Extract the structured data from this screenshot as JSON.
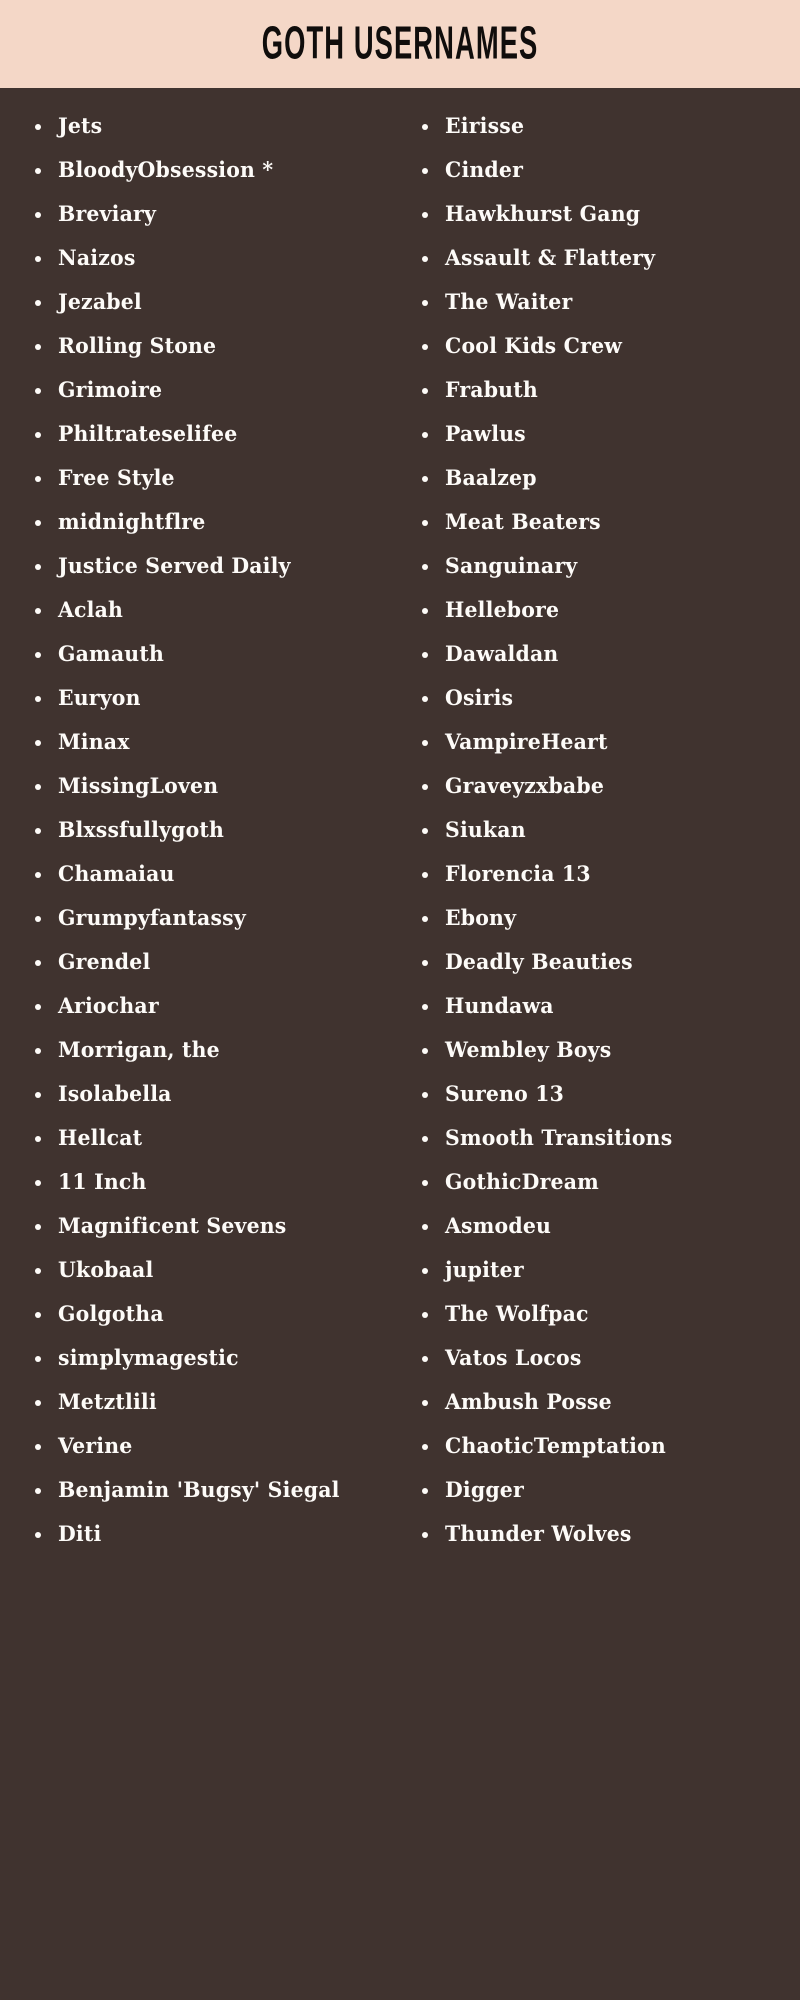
{
  "header": {
    "title": "GOTH USERNAMES",
    "background_color": "#f4d7c7",
    "text_color": "#100d0c"
  },
  "page": {
    "background_color": "#40332f",
    "text_color": "#fdfbf8",
    "bullet_glyph": "•"
  },
  "columns": {
    "left": {
      "items": [
        "Jets",
        "BloodyObsession *",
        "Breviary",
        "Naizos",
        "Jezabel",
        "Rolling Stone",
        "Grimoire",
        "Philtrateselifee",
        "Free Style",
        "midnightflre",
        "Justice Served Daily",
        "Aclah",
        "Gamauth",
        "Euryon",
        "Minax",
        "MissingLoven",
        "Blxssfullygoth",
        "Chamaiau",
        "Grumpyfantassy",
        "Grendel",
        "Ariochar",
        "Morrigan, the",
        "Isolabella",
        "Hellcat",
        "11 Inch",
        "Magnificent Sevens",
        "Ukobaal",
        "Golgotha",
        "simplymagestic",
        "Metztlili",
        "Verine",
        "Benjamin 'Bugsy' Siegal",
        "Diti"
      ]
    },
    "right": {
      "items": [
        "Eirisse",
        "Cinder",
        "Hawkhurst Gang",
        "Assault & Flattery",
        "The Waiter",
        "Cool Kids Crew",
        "Frabuth",
        "Pawlus",
        "Baalzep",
        "Meat Beaters",
        "Sanguinary",
        "Hellebore",
        "Dawaldan",
        "Osiris",
        "VampireHeart",
        "Graveyzxbabe",
        "Siukan",
        "Florencia 13",
        "Ebony",
        "Deadly Beauties",
        "Hundawa",
        "Wembley Boys",
        "Sureno 13",
        "Smooth Transitions",
        "GothicDream",
        "Asmodeu",
        "jupiter",
        "The Wolfpac",
        "Vatos Locos",
        "Ambush Posse",
        "ChaoticTemptation",
        "Digger",
        "Thunder Wolves"
      ]
    }
  }
}
